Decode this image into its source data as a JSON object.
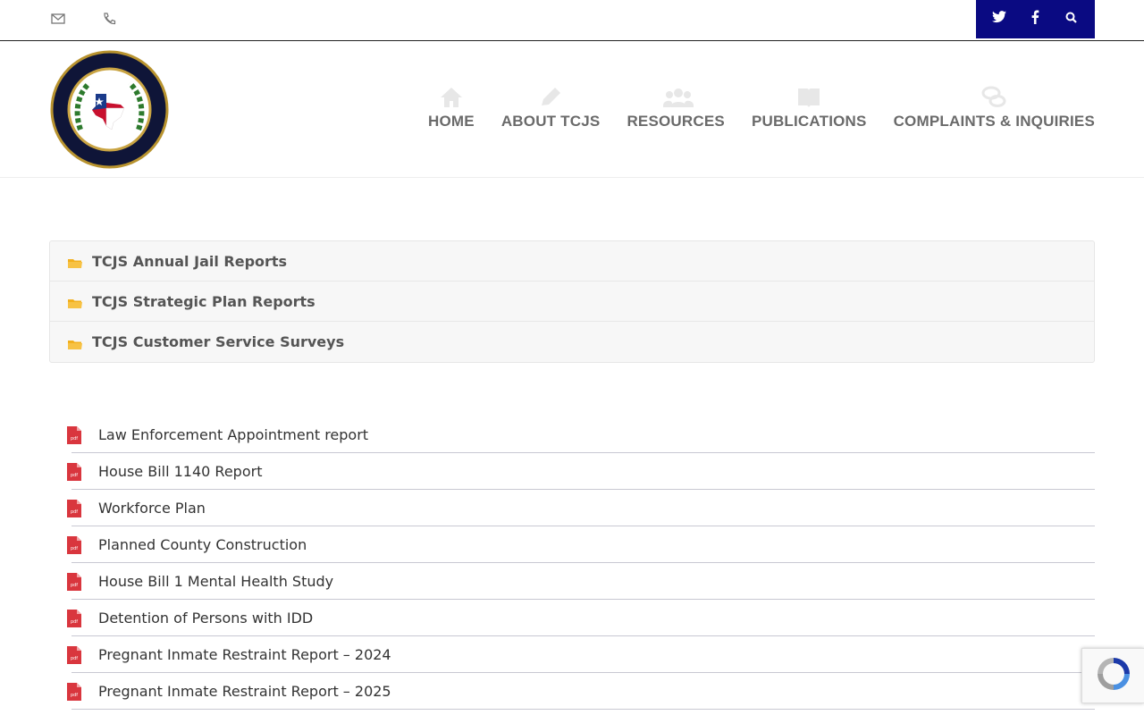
{
  "topbar": {
    "social": [
      "t",
      "f",
      "search"
    ],
    "colors": {
      "social_bg": "#0a0a82"
    }
  },
  "nav": {
    "items": [
      {
        "label": "HOME",
        "icon": "home-icon"
      },
      {
        "label": "ABOUT TCJS",
        "icon": "pencil-icon"
      },
      {
        "label": "RESOURCES",
        "icon": "users-icon"
      },
      {
        "label": "PUBLICATIONS",
        "icon": "book-icon"
      },
      {
        "label": "COMPLAINTS & INQUIRIES",
        "icon": "chat-icon"
      }
    ]
  },
  "folders": [
    "TCJS Annual Jail Reports",
    "TCJS Strategic Plan Reports",
    "TCJS Customer Service Surveys"
  ],
  "documents": [
    "Law Enforcement Appointment report",
    "House Bill 1140 Report",
    "Workforce Plan",
    "Planned County Construction",
    "House Bill 1 Mental Health Study",
    "Detention of Persons with IDD",
    "Pregnant Inmate Restraint Report – 2024",
    "Pregnant Inmate Restraint Report – 2025"
  ],
  "pdf_badge": "pdf"
}
